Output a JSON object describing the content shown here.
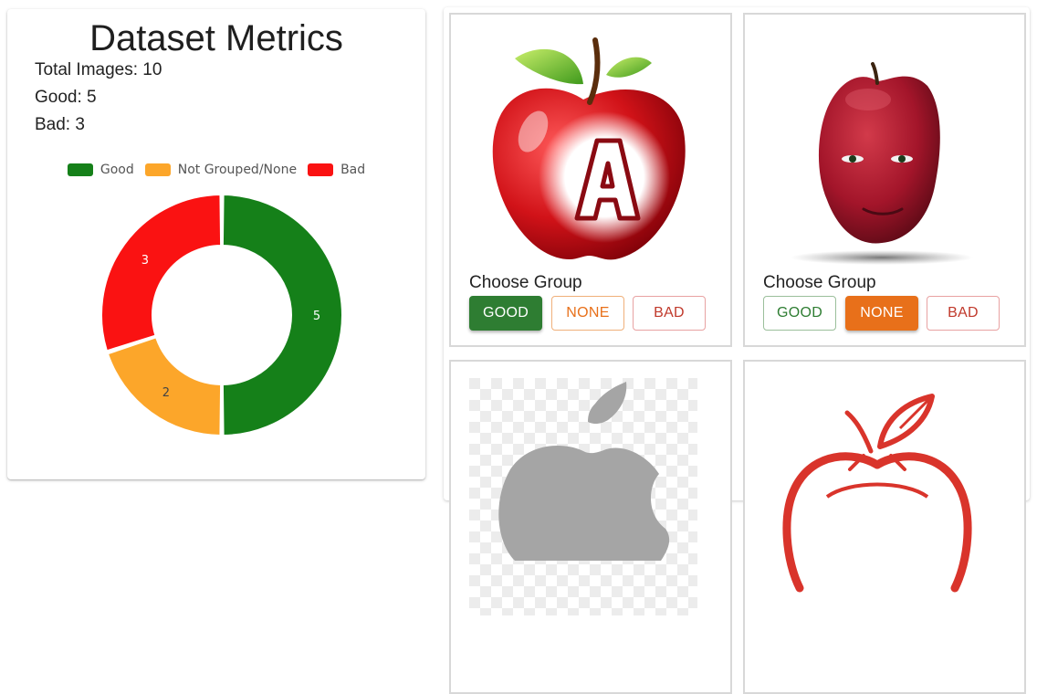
{
  "metrics": {
    "title": "Dataset Metrics",
    "total_images": "Total Images: 10",
    "good": "Good: 5",
    "bad": "Bad: 3"
  },
  "colors": {
    "good": "#158019",
    "none": "#fca62a",
    "bad": "#fa1212",
    "good_button": "#2e7d32",
    "none_button": "#e8701a"
  },
  "chart_data": {
    "type": "pie",
    "variant": "doughnut",
    "legend_position": "top",
    "series": [
      {
        "name": "Good",
        "value": 5,
        "color": "#158019"
      },
      {
        "name": "Not Grouped/None",
        "value": 2,
        "color": "#fca62a"
      },
      {
        "name": "Bad",
        "value": 3,
        "color": "#fa1212"
      }
    ]
  },
  "tiles": [
    {
      "image": "apple-letter-a",
      "choose_label": "Choose Group",
      "buttons": {
        "good": "GOOD",
        "none": "NONE",
        "bad": "BAD"
      },
      "selected": "good"
    },
    {
      "image": "apple-with-face",
      "choose_label": "Choose Group",
      "buttons": {
        "good": "GOOD",
        "none": "NONE",
        "bad": "BAD"
      },
      "selected": "none"
    },
    {
      "image": "apple-logo-on-checkerboard"
    },
    {
      "image": "apple-outline-logo"
    }
  ]
}
